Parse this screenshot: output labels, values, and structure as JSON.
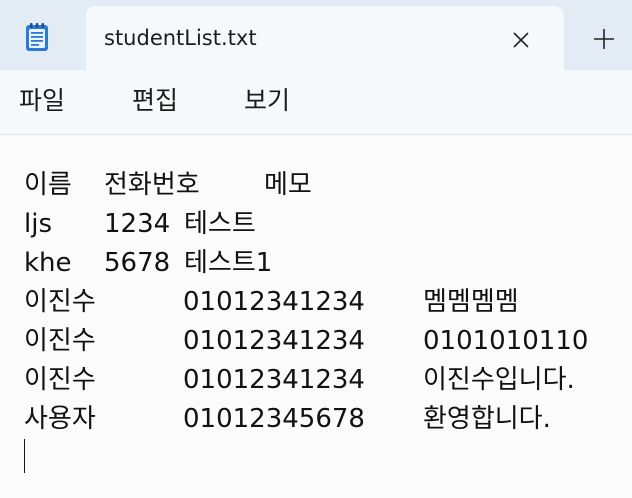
{
  "app": {
    "icon": "notepad-icon",
    "tab_title": "studentList.txt",
    "close_icon": "close-icon",
    "new_tab_icon": "plus-icon"
  },
  "menu": {
    "file": "파일",
    "edit": "편집",
    "view": "보기"
  },
  "document": {
    "header": [
      "이름",
      "전화번호",
      "메모"
    ],
    "rows": [
      [
        "ljs",
        "1234",
        "테스트"
      ],
      [
        "khe",
        "5678",
        "테스트1"
      ],
      [
        "이진수",
        "01012341234",
        "멤멤멤멤"
      ],
      [
        "이진수",
        "01012341234",
        "0101010110"
      ],
      [
        "이진수",
        "01012341234",
        "이진수입니다."
      ],
      [
        "사용자",
        "01012345678",
        "환영합니다."
      ]
    ]
  },
  "colors": {
    "tabstrip_bg": "#e3ecf4",
    "tab_bg": "#f6f9fc",
    "editor_bg": "#fbfbfb",
    "icon_blue": "#2b7bd6"
  }
}
